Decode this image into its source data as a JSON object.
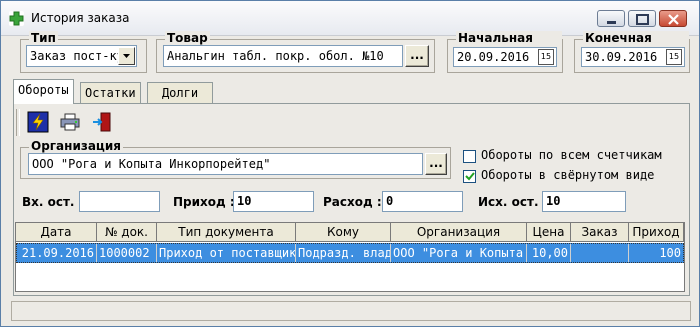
{
  "window": {
    "title": "История заказа"
  },
  "type_group": {
    "label": "Тип",
    "value": "Заказ пост-ку"
  },
  "goods_group": {
    "label": "Товар",
    "value": "Анальгин табл. покр. обол. №10",
    "browse_label": "..."
  },
  "start_date_group": {
    "label": "Начальная дата",
    "value": "20.09.2016"
  },
  "end_date_group": {
    "label": "Конечная дата",
    "value": "30.09.2016"
  },
  "tabs": [
    {
      "label": "Обороты",
      "active": true
    },
    {
      "label": "Остатки",
      "active": false
    },
    {
      "label": "Долги",
      "active": false
    }
  ],
  "toolbar": {
    "icons": [
      "lightning-icon",
      "printer-icon",
      "exit-door-icon"
    ]
  },
  "org_group": {
    "label": "Организация",
    "value": "ООО \"Рога и Копыта Инкорпорейтед\"",
    "browse_label": "..."
  },
  "checkboxes": [
    {
      "label": "Обороты по всем счетчикам",
      "checked": false
    },
    {
      "label": "Обороты в свёрнутом виде",
      "checked": true
    }
  ],
  "totals": {
    "in_label": "Вх. ост. :",
    "in_value": "",
    "income_label": "Приход :",
    "income_value": "10",
    "expense_label": "Расход :",
    "expense_value": "0",
    "out_label": "Исх. ост. :",
    "out_value": "10"
  },
  "grid": {
    "columns": [
      "Дата",
      "№ док.",
      "Тип документа",
      "Кому",
      "Организация",
      "Цена",
      "Заказ",
      "Приход"
    ],
    "rows": [
      [
        "21.09.2016",
        "1000002",
        "Приход от поставщика",
        "Подразд. влад.",
        "ООО \"Рога и Копыта",
        "10,00",
        "",
        "100"
      ]
    ]
  },
  "colors": {
    "selection": "#3d8ee0",
    "window_bg": "#eceae5"
  }
}
